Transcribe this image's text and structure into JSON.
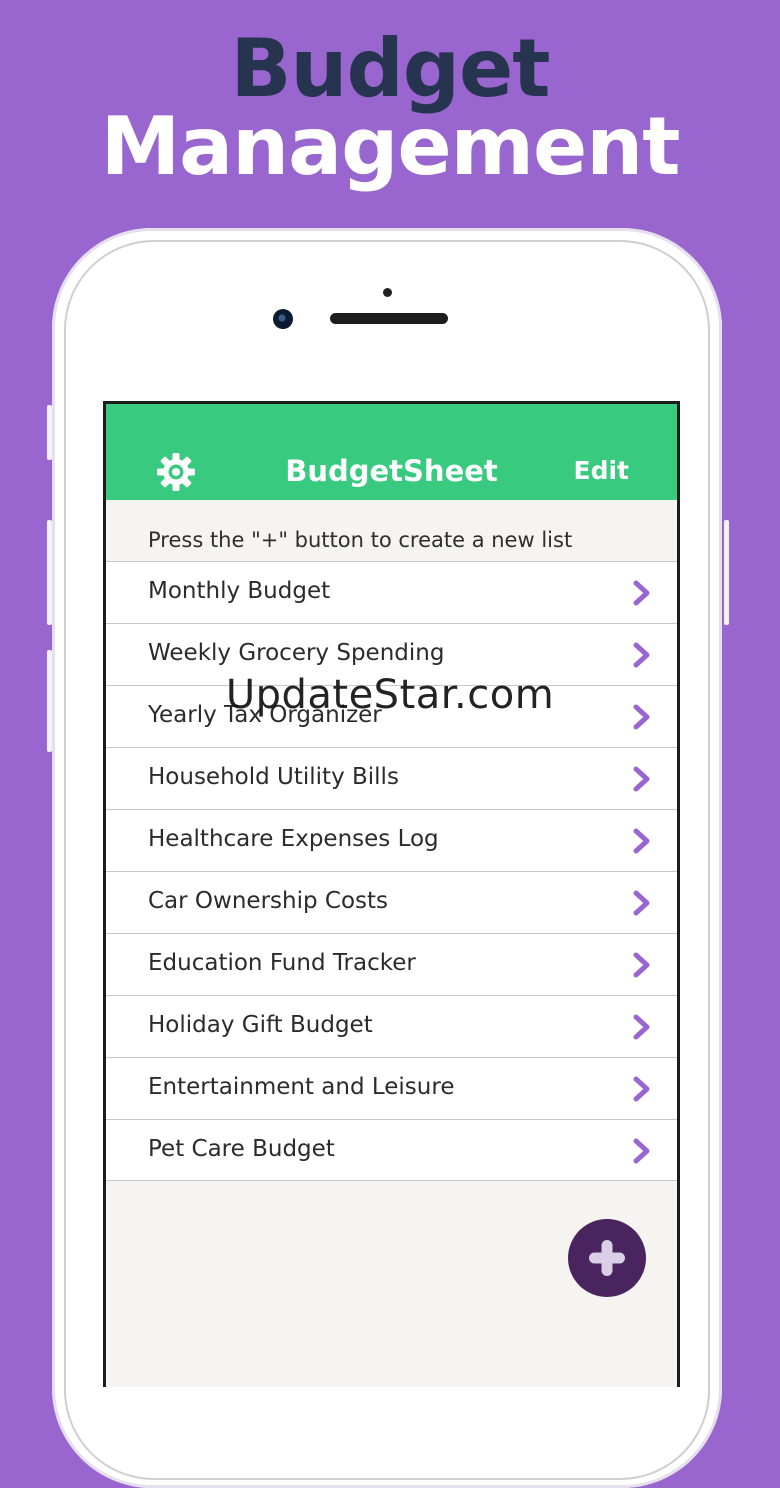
{
  "promo": {
    "headline_line1": "Budget",
    "headline_line2": "Management"
  },
  "app": {
    "title": "BudgetSheet",
    "edit_label": "Edit",
    "settings_icon": "gear-icon",
    "hint": "Press the \"+\" button to create a new list",
    "lists": [
      {
        "label": "Monthly Budget"
      },
      {
        "label": "Weekly Grocery Spending"
      },
      {
        "label": "Yearly Tax Organizer"
      },
      {
        "label": "Household Utility Bills"
      },
      {
        "label": "Healthcare Expenses Log"
      },
      {
        "label": "Car Ownership Costs"
      },
      {
        "label": "Education Fund Tracker"
      },
      {
        "label": "Holiday Gift Budget"
      },
      {
        "label": "Entertainment and Leisure"
      },
      {
        "label": "Pet Care Budget"
      }
    ],
    "add_icon": "plus-icon"
  },
  "watermark": "UpdateStar.com",
  "colors": {
    "background": "#9966cf",
    "appbar": "#38cb7f",
    "chevron": "#9966cf",
    "fab": "#4a245f",
    "headline_dark": "#27344f"
  }
}
